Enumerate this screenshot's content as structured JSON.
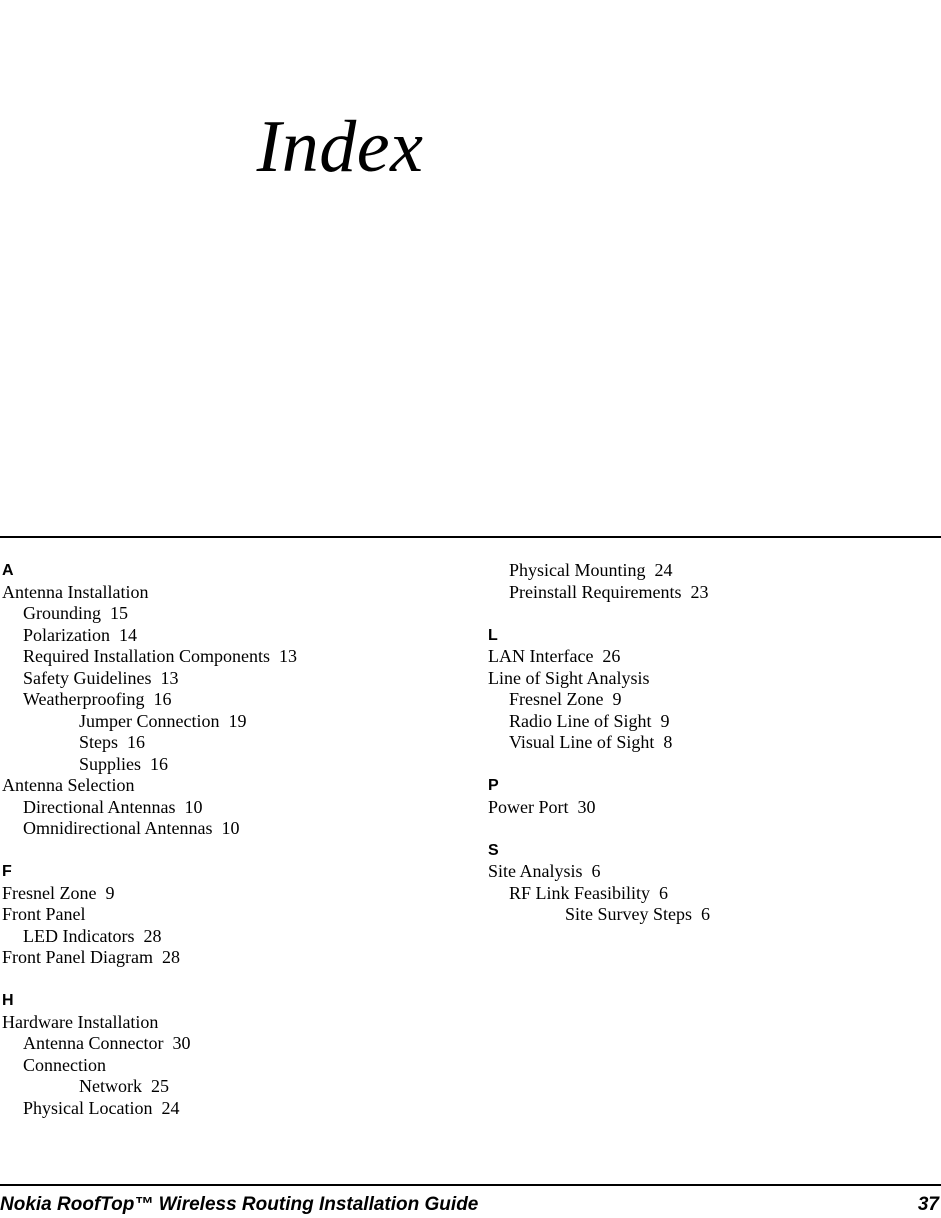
{
  "page": {
    "title": "Index"
  },
  "footer": {
    "guide_title": "Nokia RoofTop™ Wireless Routing Installation Guide",
    "page_number": "37"
  },
  "index": {
    "left_column": [
      {
        "letter": "A",
        "entries": [
          {
            "level": 0,
            "text": "Antenna Installation"
          },
          {
            "level": 1,
            "text": "Grounding  15"
          },
          {
            "level": 1,
            "text": "Polarization  14"
          },
          {
            "level": 1,
            "text": "Required Installation Components  13"
          },
          {
            "level": 1,
            "text": "Safety Guidelines  13"
          },
          {
            "level": 1,
            "text": "Weatherproofing  16"
          },
          {
            "level": 2,
            "text": "Jumper Connection  19"
          },
          {
            "level": 2,
            "text": "Steps  16"
          },
          {
            "level": 2,
            "text": "Supplies  16"
          },
          {
            "level": 0,
            "text": "Antenna Selection"
          },
          {
            "level": 1,
            "text": "Directional Antennas  10"
          },
          {
            "level": 1,
            "text": "Omnidirectional Antennas  10"
          }
        ]
      },
      {
        "letter": "F",
        "entries": [
          {
            "level": 0,
            "text": "Fresnel Zone  9"
          },
          {
            "level": 0,
            "text": "Front Panel"
          },
          {
            "level": 1,
            "text": "LED Indicators  28"
          },
          {
            "level": 0,
            "text": "Front Panel Diagram  28"
          }
        ]
      },
      {
        "letter": "H",
        "entries": [
          {
            "level": 0,
            "text": "Hardware Installation"
          },
          {
            "level": 1,
            "text": "Antenna Connector  30"
          },
          {
            "level": 1,
            "text": "Connection"
          },
          {
            "level": 2,
            "text": "Network  25"
          },
          {
            "level": 1,
            "text": "Physical Location  24"
          }
        ]
      }
    ],
    "right_column": [
      {
        "letter": "",
        "entries": [
          {
            "level": 1,
            "text": "Physical Mounting  24"
          },
          {
            "level": 1,
            "text": "Preinstall Requirements  23"
          }
        ]
      },
      {
        "letter": "L",
        "entries": [
          {
            "level": 0,
            "text": "LAN Interface  26"
          },
          {
            "level": 0,
            "text": "Line of Sight Analysis"
          },
          {
            "level": 1,
            "text": "Fresnel Zone  9"
          },
          {
            "level": 1,
            "text": "Radio Line of Sight  9"
          },
          {
            "level": 1,
            "text": "Visual Line of Sight  8"
          }
        ]
      },
      {
        "letter": "P",
        "entries": [
          {
            "level": 0,
            "text": "Power Port  30"
          }
        ]
      },
      {
        "letter": "S",
        "entries": [
          {
            "level": 0,
            "text": "Site Analysis  6"
          },
          {
            "level": 1,
            "text": "RF Link Feasibility  6"
          },
          {
            "level": 2,
            "text": "Site Survey Steps  6"
          }
        ]
      }
    ]
  }
}
